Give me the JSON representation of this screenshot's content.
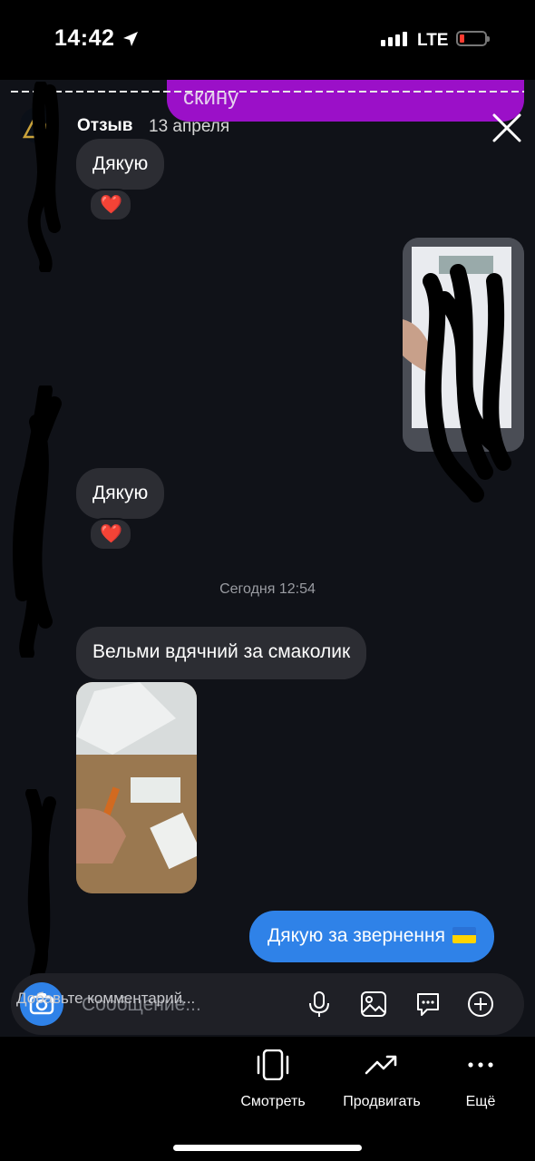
{
  "status_bar": {
    "time": "14:42",
    "network": "LTE"
  },
  "previous_message": {
    "text": "скину"
  },
  "story": {
    "name": "Отзыв",
    "date": "13 апреля"
  },
  "chat": {
    "message1": "Дякую",
    "reaction1": "❤️",
    "message2": "Дякую",
    "reaction2": "❤️",
    "divider_time": "Сегодня 12:54",
    "message3": "Вельми вдячний за смаколик",
    "outgoing_message": "Дякую за звернення"
  },
  "composer": {
    "placeholder": "Сообщение...",
    "comment_hint": "Добавьте комментарий..."
  },
  "bottom_actions": {
    "view_label": "Смотреть",
    "promote_label": "Продвигать",
    "more_label": "Ещё"
  },
  "colors": {
    "background": "#101218",
    "incoming_bubble": "#2c2d33",
    "outgoing_bubble": "#2f82e8",
    "purple_bubble": "#9b10c8",
    "heart": "#e23b3b"
  }
}
